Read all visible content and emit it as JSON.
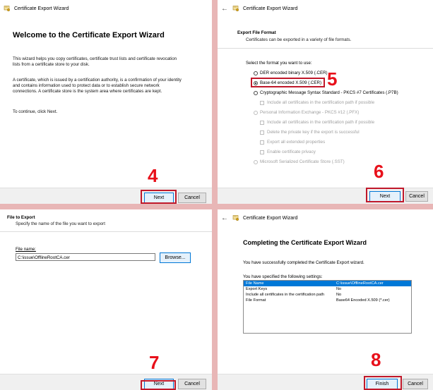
{
  "window_title": "Certificate Export Wizard",
  "buttons": {
    "next": "Next",
    "cancel": "Cancel",
    "browse": "Browse...",
    "finish": "Finish"
  },
  "steps": [
    "4",
    "5",
    "6",
    "7",
    "8"
  ],
  "welcome": {
    "title": "Welcome to the Certificate Export Wizard",
    "para1_line1": "This wizard helps you copy certificates, certificate trust lists and certificate revocation",
    "para1_line2": "lists from a certificate store to your disk.",
    "para2_line1": "A certificate, which is issued by a certification authority, is a confirmation of your identity",
    "para2_line2": "and contains information used to protect data or to establish secure network",
    "para2_line3": "connections. A certificate store is the system area where certificates are kept.",
    "para3": "To continue, click Next."
  },
  "format": {
    "title": "Export File Format",
    "subtitle": "Certificates can be exported in a variety of file formats.",
    "prompt": "Select the format you want to use:",
    "options": [
      "DER encoded binary X.509 (.CER)",
      "Base-64 encoded X.509 (.CER)",
      "Cryptographic Message Syntax Standard - PKCS #7 Certificates (.P7B)",
      "Include all certificates in the certification path if possible",
      "Personal Information Exchange - PKCS #12 (.PFX)",
      "Include all certificates in the certification path if possible",
      "Delete the private key if the export is successful",
      "Export all extended properties",
      "Enable certificate privacy",
      "Microsoft Serialized Certificate Store (.SST)"
    ],
    "selected_option": "Base-64 encoded X.509 (.CER)"
  },
  "file_export": {
    "title": "File to Export",
    "subtitle": "Specify the name of the file you want to export",
    "field_label": "File name:",
    "file_name": "C:\\issue\\OfflineRootCA.cer"
  },
  "completing": {
    "title": "Completing the Certificate Export Wizard",
    "intro": "You have successfully completed the Certificate Export wizard.",
    "settings_label": "You have specified the following settings:",
    "settings": [
      {
        "key": "File Name",
        "value": "C:\\issue\\OfflineRootCA.cer"
      },
      {
        "key": "Export Keys",
        "value": "No"
      },
      {
        "key": "Include all certificates in the certification path",
        "value": "No"
      },
      {
        "key": "File Format",
        "value": "Base64 Encoded X.509 (*.cer)"
      }
    ]
  },
  "colors": {
    "accent": "#0078d7",
    "highlight": "#c0182a",
    "step_number": "#e8101a",
    "background": "#e8b6b6"
  },
  "icons": {
    "back": "back-arrow-icon",
    "app": "certificate-icon"
  }
}
